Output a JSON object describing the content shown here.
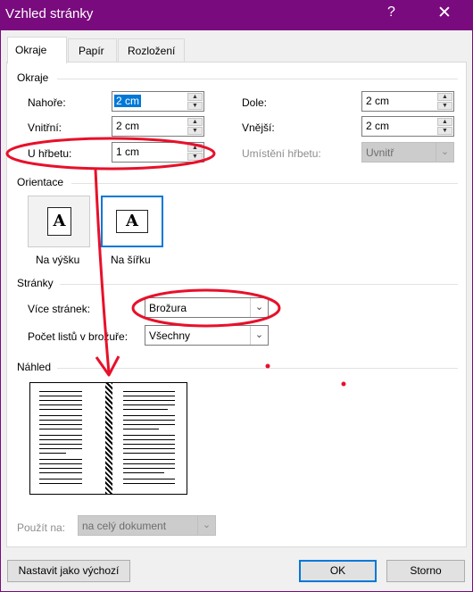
{
  "window": {
    "title": "Vzhled stránky",
    "help_glyph": "?",
    "close_glyph": "✕"
  },
  "tabs": [
    "Okraje",
    "Papír",
    "Rozložení"
  ],
  "margins": {
    "section": "Okraje",
    "top": {
      "label": "Nahoře:",
      "value": "2 cm"
    },
    "bottom": {
      "label": "Dole:",
      "value": "2 cm"
    },
    "inside": {
      "label": "Vnitřní:",
      "value": "2 cm"
    },
    "outside": {
      "label": "Vnější:",
      "value": "2 cm"
    },
    "gutter": {
      "label": "U hřbetu:",
      "value": "1 cm"
    },
    "gutter_position": {
      "label": "Umístění hřbetu:",
      "value": "Uvnitř"
    }
  },
  "orientation": {
    "section": "Orientace",
    "portrait": "Na výšku",
    "landscape": "Na šířku",
    "icon_letter": "A"
  },
  "pages": {
    "section": "Stránky",
    "multiple": {
      "label": "Více stránek:",
      "value": "Brožura"
    },
    "sheets": {
      "label": "Počet listů v brožuře:",
      "value": "Všechny"
    }
  },
  "preview": {
    "section": "Náhled"
  },
  "apply_to": {
    "label": "Použít na:",
    "value": "na celý dokument"
  },
  "buttons": {
    "set_default": "Nastavit jako výchozí",
    "ok": "OK",
    "cancel": "Storno"
  },
  "colors": {
    "titlebar": "#7a0b7e",
    "accent": "#0078d7",
    "annotation": "#e8102a"
  }
}
